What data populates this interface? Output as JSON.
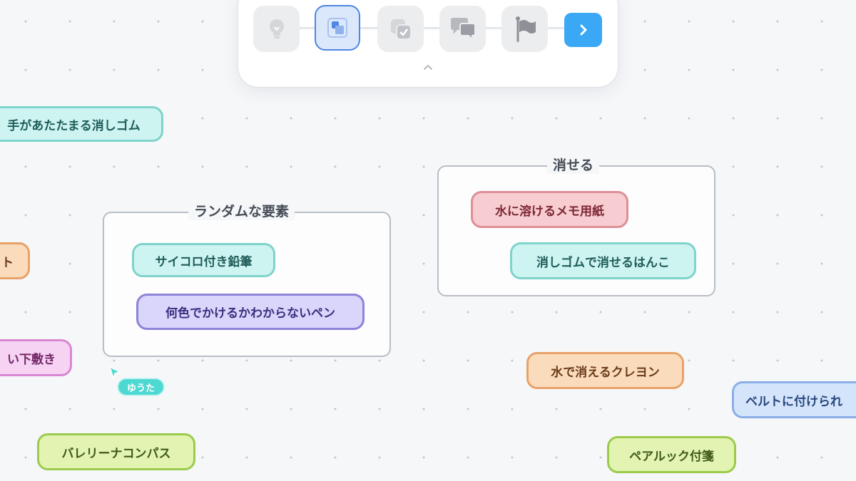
{
  "toolbar": {
    "steps": [
      {
        "icon": "lightbulb-icon",
        "state": "inactive"
      },
      {
        "icon": "group-squares-icon",
        "state": "active"
      },
      {
        "icon": "checked-squares-icon",
        "state": "inactive"
      },
      {
        "icon": "chat-bubbles-icon",
        "state": "inactive"
      },
      {
        "icon": "flag-icon",
        "state": "inactive"
      },
      {
        "icon": "chevron-right-icon",
        "state": "next"
      }
    ],
    "collapse_icon": "chevron-up-icon",
    "accent_color": "#4f86e0",
    "next_color": "#3aa8f5"
  },
  "groups": {
    "random": {
      "title": "ランダムな要素",
      "items": [
        "サイコロ付き鉛筆",
        "何色でかけるかわからないペン"
      ]
    },
    "erasable": {
      "title": "消せる",
      "items": [
        "水に溶けるメモ用紙",
        "消しゴムで消せるはんこ"
      ]
    }
  },
  "chips": {
    "warm_eraser": "手があたたまる消しゴム",
    "partial_orange": "ト",
    "partial_magenta": "い下敷き",
    "ballerina_compass": "バレリーナコンパス",
    "water_crayon": "水で消えるクレヨン",
    "belt_item": "ベルトに付けられ",
    "pair_sticky": "ペアルック付箋"
  },
  "cursor": {
    "user": "ゆうた",
    "color": "#4dd9d2"
  }
}
